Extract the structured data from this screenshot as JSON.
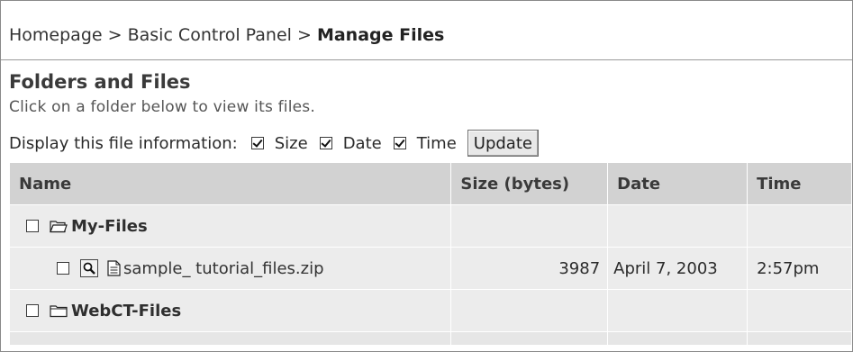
{
  "breadcrumb": {
    "items": [
      "Homepage",
      "Basic Control Panel"
    ],
    "separator": ">",
    "current": "Manage Files"
  },
  "section": {
    "title": "Folders and Files",
    "instruction": "Click on a folder below to view its files."
  },
  "display_options": {
    "label": "Display this file information:",
    "options": [
      {
        "label": "Size",
        "checked": true
      },
      {
        "label": "Date",
        "checked": true
      },
      {
        "label": "Time",
        "checked": true
      }
    ],
    "update_label": "Update"
  },
  "table": {
    "columns": [
      "Name",
      "Size (bytes)",
      "Date",
      "Time"
    ],
    "rows": [
      {
        "type": "folder",
        "icon": "open-folder-icon",
        "name": "My-Files",
        "checked": false,
        "size": "",
        "date": "",
        "time": ""
      },
      {
        "type": "file",
        "icon": "file-icon",
        "name": "sample_ tutorial_files.zip",
        "checked": false,
        "size": "3987",
        "date": "April 7, 2003",
        "time": "2:57pm"
      },
      {
        "type": "folder",
        "icon": "folder-icon",
        "name": "WebCT-Files",
        "checked": false,
        "size": "",
        "date": "",
        "time": ""
      }
    ]
  },
  "colors": {
    "header_bg": "#d2d2d2",
    "row_bg": "#ececec",
    "text": "#2b2b2b",
    "border": "#8a8a8a"
  }
}
